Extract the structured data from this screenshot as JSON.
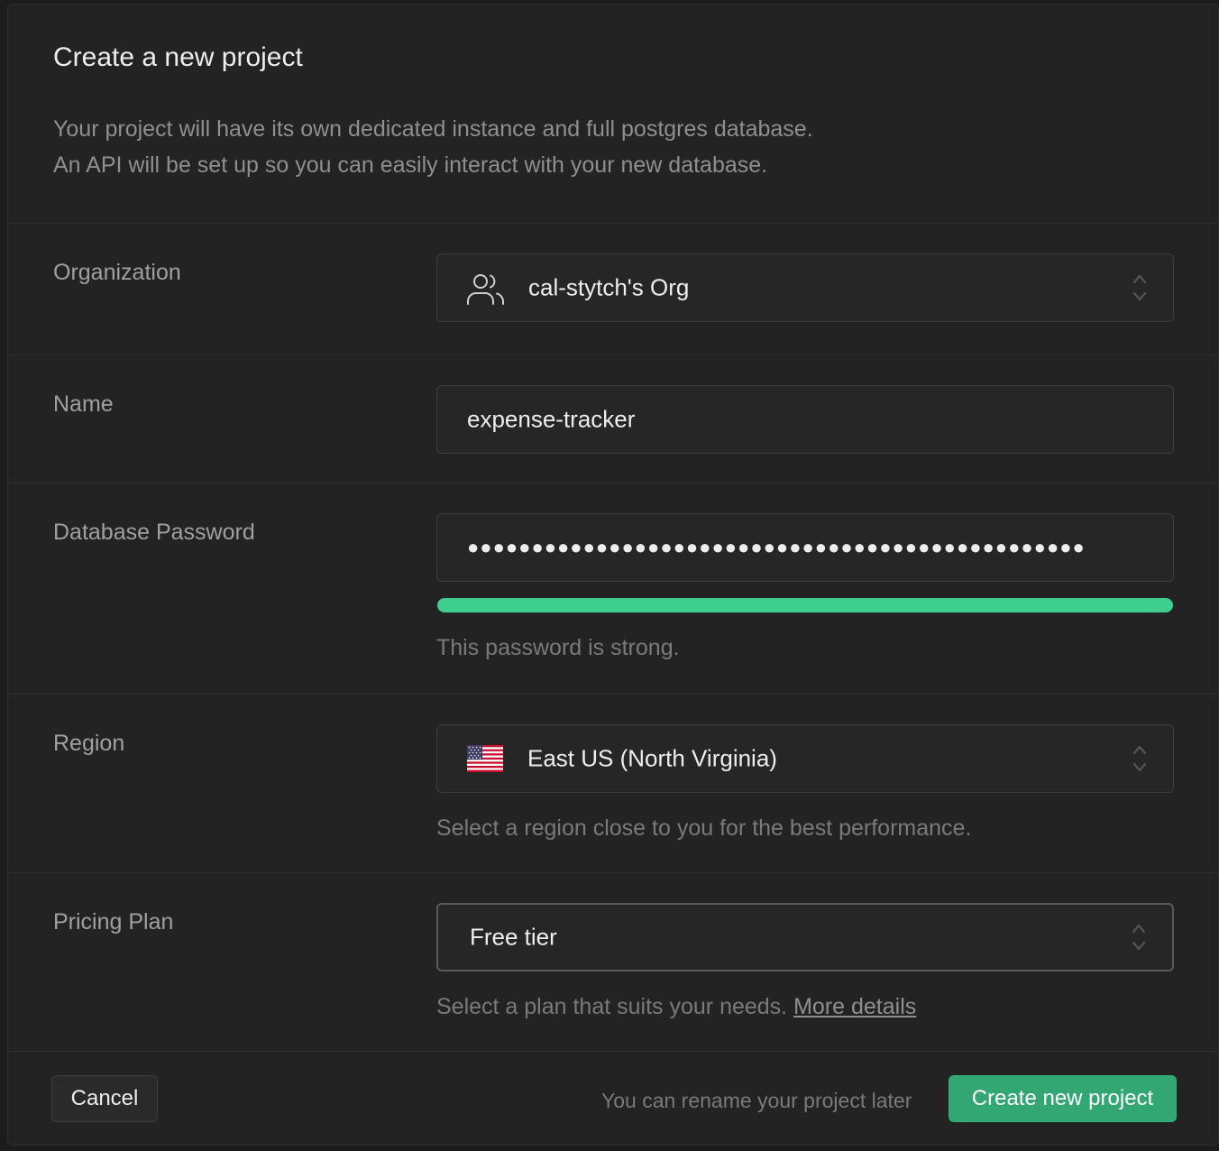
{
  "dialog": {
    "title": "Create a new project",
    "description_line1": "Your project will have its own dedicated instance and full postgres database.",
    "description_line2": "An API will be set up so you can easily interact with your new database."
  },
  "organization": {
    "label": "Organization",
    "value": "cal-stytch's Org",
    "icon": "users-icon"
  },
  "name": {
    "label": "Name",
    "value": "expense-tracker"
  },
  "password": {
    "label": "Database Password",
    "masked_value": "●●●●●●●●●●●●●●●●●●●●●●●●●●●●●●●●●●●●●●●●●●●●●●●●",
    "strength_fraction": 1.0,
    "strength_color": "#3ecf8e",
    "strength_text": "This password is strong."
  },
  "region": {
    "label": "Region",
    "value": "East US (North Virginia)",
    "icon": "us-flag-icon",
    "help": "Select a region close to you for the best performance."
  },
  "pricing": {
    "label": "Pricing Plan",
    "value": "Free tier",
    "help": "Select a plan that suits your needs.",
    "link": "More details"
  },
  "footer": {
    "cancel_label": "Cancel",
    "note": "You can rename your project later",
    "create_label": "Create new project"
  },
  "colors": {
    "accent": "#3ecf8e",
    "background": "#232323"
  }
}
